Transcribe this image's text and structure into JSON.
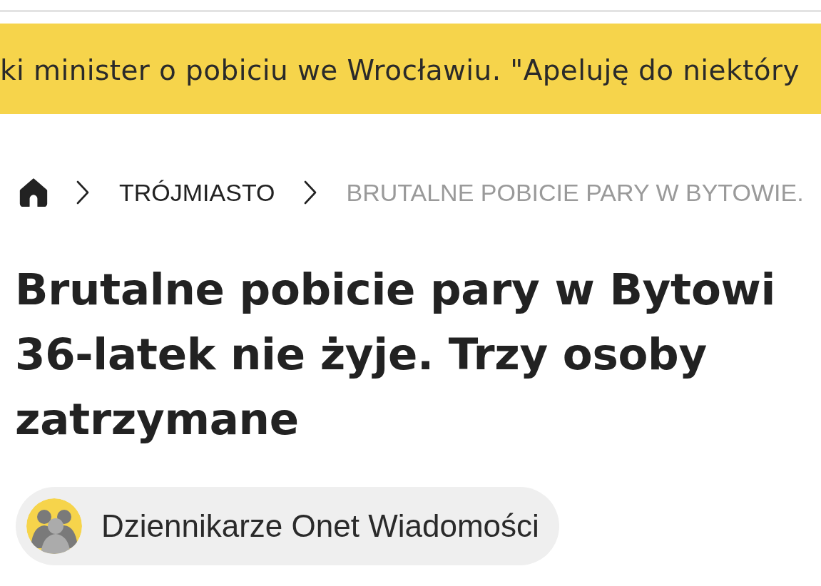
{
  "ticker": {
    "text": "ki minister o pobiciu we Wrocławiu. \"Apeluję do niektóry"
  },
  "breadcrumb": {
    "items": [
      {
        "kind": "home"
      },
      {
        "kind": "link",
        "label": "TRÓJMIASTO"
      },
      {
        "kind": "current",
        "label": "BRUTALNE POBICIE PARY W BYTOWIE."
      }
    ]
  },
  "headline": {
    "lines": [
      "Brutalne pobicie pary w Bytowi",
      "36-latek nie żyje. Trzy osoby",
      "zatrzymane"
    ]
  },
  "author": {
    "name": "Dziennikarze Onet Wiadomości"
  }
}
